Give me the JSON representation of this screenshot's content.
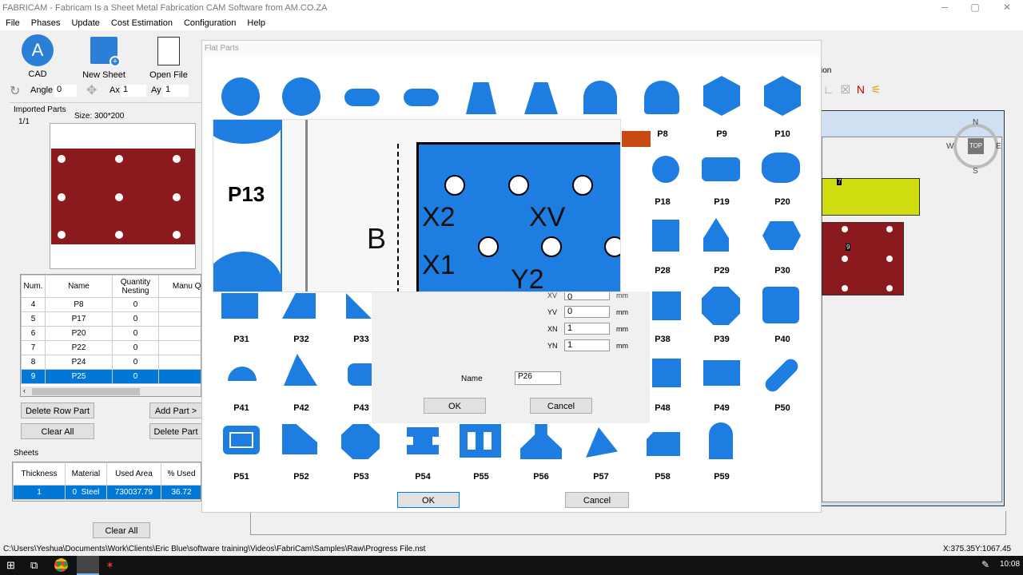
{
  "window": {
    "title": "FABRICAM - Fabricam Is a Sheet Metal Fabrication CAM Software from AM.CO.ZA",
    "min": "─",
    "max": "▢",
    "close": "✕"
  },
  "menu": [
    "File",
    "Phases",
    "Update",
    "Cost Estimation",
    "Configuration",
    "Help"
  ],
  "toolbar": {
    "cad": "CAD",
    "new_sheet": "New Sheet",
    "open_file": "Open File",
    "cad_glyph": "A"
  },
  "transform": {
    "angle_label": "Angle",
    "angle_value": "0",
    "ax_label": "Ax",
    "ax_value": "1",
    "ay_label": "Ay",
    "ay_value": "1"
  },
  "imported": {
    "title": "Imported Parts",
    "page": "1/1",
    "size": "Size: 300*200"
  },
  "parts_table": {
    "headers": [
      "Num.",
      "Name",
      "Quantity Nesting",
      "Manu Quan"
    ],
    "rows": [
      [
        "4",
        "P8",
        "0"
      ],
      [
        "5",
        "P17",
        "0"
      ],
      [
        "6",
        "P20",
        "0"
      ],
      [
        "7",
        "P22",
        "0"
      ],
      [
        "8",
        "P24",
        "0"
      ],
      [
        "9",
        "P25",
        "0"
      ]
    ],
    "selected_index": 5
  },
  "buttons": {
    "delete_row_part": "Delete Row Part",
    "add_part": "Add Part >",
    "clear_all": "Clear All",
    "delete_part": "Delete Part",
    "sheets_clear_all": "Clear All"
  },
  "sheets": {
    "title": "Sheets",
    "headers": [
      "Thickness",
      "Material",
      "Used Area",
      "% Used"
    ],
    "row": [
      "1",
      "0",
      "Steel",
      "730037.79",
      "36.72"
    ]
  },
  "flat_parts": {
    "title": "Flat Parts",
    "row1": [
      "",
      "",
      "",
      "",
      "",
      "",
      "",
      "",
      "P8",
      "P9",
      "P10"
    ],
    "row2_right": [
      "P18",
      "P19",
      "P20"
    ],
    "row3_right": [
      "P28",
      "P29",
      "P30"
    ],
    "row4": [
      "P31",
      "P32",
      "P33",
      "P38",
      "P39",
      "P40"
    ],
    "row5": [
      "P41",
      "P42",
      "P43",
      "P48",
      "P49",
      "P50"
    ],
    "row6": [
      "P51",
      "P52",
      "P53",
      "P54",
      "P55",
      "P56",
      "P57",
      "P58",
      "P59"
    ],
    "ok": "OK",
    "cancel": "Cancel"
  },
  "inner": {
    "fields": [
      {
        "label": "XV",
        "value": "0",
        "unit": "mm"
      },
      {
        "label": "YV",
        "value": "0",
        "unit": "mm"
      },
      {
        "label": "XN",
        "value": "1",
        "unit": "mm"
      },
      {
        "label": "YN",
        "value": "1",
        "unit": "mm"
      }
    ],
    "name_label": "Name",
    "name_value": "P26",
    "ok": "OK",
    "cancel": "Cancel",
    "preview_left_label": "P13",
    "preview_labels": {
      "b": "B",
      "x2": "X2",
      "xv": "XV",
      "x1": "X1",
      "y2": "Y2"
    }
  },
  "right": {
    "partial": "ion",
    "compass": {
      "n": "N",
      "s": "S",
      "w": "W",
      "e": "E",
      "top": "TOP"
    },
    "part7": "7",
    "part9": "9"
  },
  "status": {
    "path": "C:\\Users\\Yeshua\\Documents\\Work\\Clients\\Eric Blue\\software training\\Videos\\FabriCam\\Samples\\Raw\\Progress File.nst",
    "coords": "X:375.35Y:1067.45"
  },
  "taskbar": {
    "time": "10:08"
  },
  "colors": {
    "accent": "#0078d7",
    "part_blue": "#1e7de0",
    "sheet_red": "#8b1a1e",
    "yellow": "#cfdc10"
  }
}
